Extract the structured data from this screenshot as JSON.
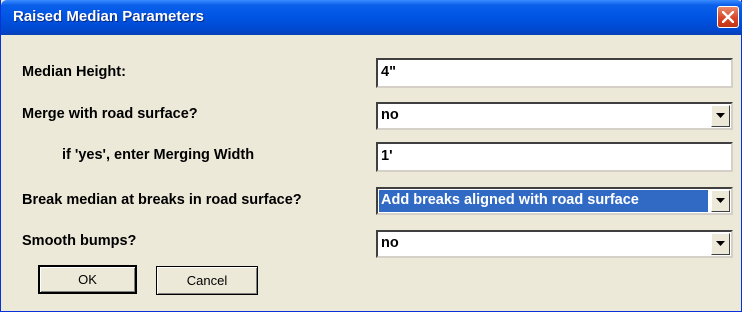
{
  "window": {
    "title": "Raised Median Parameters",
    "close_icon": "close-icon"
  },
  "form": {
    "median_height": {
      "label": "Median Height:",
      "value": "4\""
    },
    "merge": {
      "label": "Merge with road surface?",
      "value": "no"
    },
    "merging_width": {
      "label": "if 'yes', enter Merging Width",
      "value": "1'"
    },
    "break_median": {
      "label": "Break median at breaks in road surface?",
      "value": "Add breaks aligned with road surface"
    },
    "smooth_bumps": {
      "label": "Smooth bumps?",
      "value": "no"
    }
  },
  "buttons": {
    "ok": "OK",
    "cancel": "Cancel"
  },
  "colors": {
    "titlebar": "#0054e3",
    "face": "#ece9d8",
    "highlight": "#316ac5",
    "close": "#d8462a"
  }
}
